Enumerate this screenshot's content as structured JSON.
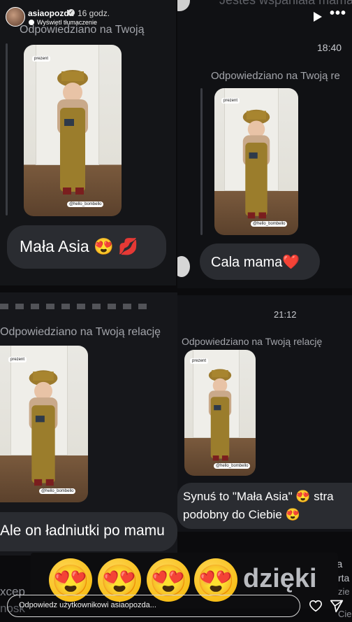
{
  "header": {
    "username": "asiaopozda",
    "time_ago": "16 godz.",
    "translation_link": "Wyświetl tłumaczenie"
  },
  "left": {
    "replied_top": "Odpowiedziano na Twoją",
    "photo_tag": "prezent",
    "photo_handle": "@hello_bombello",
    "message_1": "Mała Asia 😍 💋",
    "replied_bottom": "Odpowiedziano na Twoją relację",
    "message_2": "Ale on ładniutki po mamu"
  },
  "right": {
    "top_cut_text": "Jesteś wspaniała mama",
    "time_1": "18:40",
    "replied_1": "Odpowiedziano na Twoją re",
    "message_1": "Cala mama❤️",
    "time_2": "21:12",
    "replied_2": "Odpowiedziano na Twoją relację",
    "message_2_line1": "Synuś to \"Mała Asia\" 😍 stra",
    "message_2_line2": "podobny do Ciebie 😍",
    "peek_1": "zie",
    "peek_2": "Cie",
    "peek_3": "a",
    "peek_4": "rta"
  },
  "bottom": {
    "peek_left_1": "xcep",
    "peek_left_2": "nosk",
    "reaction_emojis": [
      "😍",
      "😍",
      "😍",
      "😍"
    ],
    "overlay_text": "dzięki",
    "reply_placeholder": "Odpowiedz użytkownikowi asiaopozda..."
  }
}
